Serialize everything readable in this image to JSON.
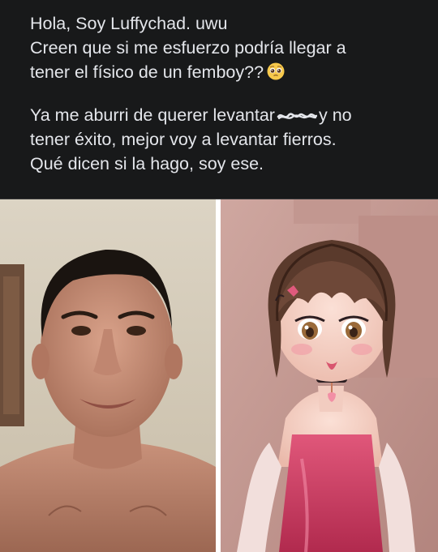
{
  "post": {
    "line1": "Hola, Soy Luffychad. uwu",
    "line2": "Creen que si me esfuerzo podría llegar a",
    "line3": "tener el físico de un femboy??",
    "line4_a": "Ya me aburri de querer levantar",
    "line4_b": "y no",
    "line5": "tener éxito, mejor voy a levantar fierros.",
    "line6": "Qué dicen si la hago, soy ese.",
    "emoji": "pleading-face-icon",
    "colors": {
      "background": "#18191a",
      "text": "#e4e6eb"
    }
  },
  "images": {
    "left": "photo-shirtless-man",
    "right": "illustration-anime-femboy"
  }
}
